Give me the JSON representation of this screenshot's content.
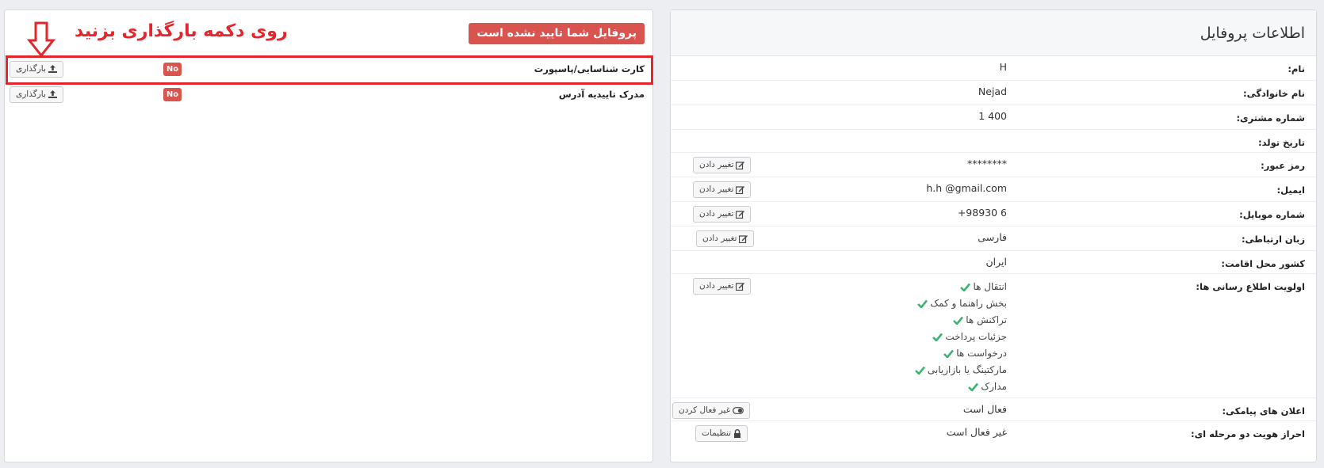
{
  "documents": {
    "warning_badge": "پروفایل شما تایید نشده است",
    "annotation": "روی دکمه بارگذاری بزنید",
    "rows": [
      {
        "label": "کارت شناسایی/پاسپورت",
        "status": "No",
        "button": "بارگذاری"
      },
      {
        "label": "مدرک تاییدیه آدرس",
        "status": "No",
        "button": "بارگذاری"
      }
    ]
  },
  "profile": {
    "title": "اطلاعات پروفایل",
    "rows": {
      "first_name": {
        "label": "نام:",
        "value": "H"
      },
      "last_name": {
        "label": "نام خانوادگی:",
        "value": "Nejad"
      },
      "customer_no": {
        "label": "شماره مشتری:",
        "value": "1 400"
      },
      "birth_date": {
        "label": "تاریخ تولد:",
        "value": ""
      },
      "password": {
        "label": "رمز عبور:",
        "value": "********",
        "button": "تغییر دادن"
      },
      "email": {
        "label": "ایمیل:",
        "value": "h.h          @gmail.com",
        "button": "تغییر دادن"
      },
      "mobile": {
        "label": "شماره موبایل:",
        "value": "+98930           6",
        "button": "تغییر دادن"
      },
      "language": {
        "label": "زبان ارتباطی:",
        "value": "فارسی",
        "button": "تغییر دادن"
      },
      "country": {
        "label": "کشور محل اقامت:",
        "value": "ایران"
      },
      "notifications": {
        "label": "اولویت اطلاع رسانی ها:",
        "button": "تغییر دادن",
        "items": [
          "انتقال ها",
          "بخش راهنما و کمک",
          "تراکنش ها",
          "جزئیات پرداخت",
          "درخواست ها",
          "مارکتینگ یا بازاریابی",
          "مدارک"
        ]
      },
      "sms": {
        "label": "اعلان های پیامکی:",
        "value": "فعال است",
        "button": "غیر فعال کردن"
      },
      "two_factor": {
        "label": "احراز هویت دو مرحله ای:",
        "value": "غیر فعال است",
        "button": "تنظیمات"
      }
    }
  },
  "colors": {
    "danger": "#d9534f",
    "annotation": "#e4252b",
    "check": "#3cb371"
  },
  "icons": {
    "upload": "upload-icon",
    "edit": "edit-icon",
    "toggle": "toggle-icon",
    "lock": "lock-icon",
    "check": "check-icon",
    "arrow": "down-arrow-icon"
  }
}
